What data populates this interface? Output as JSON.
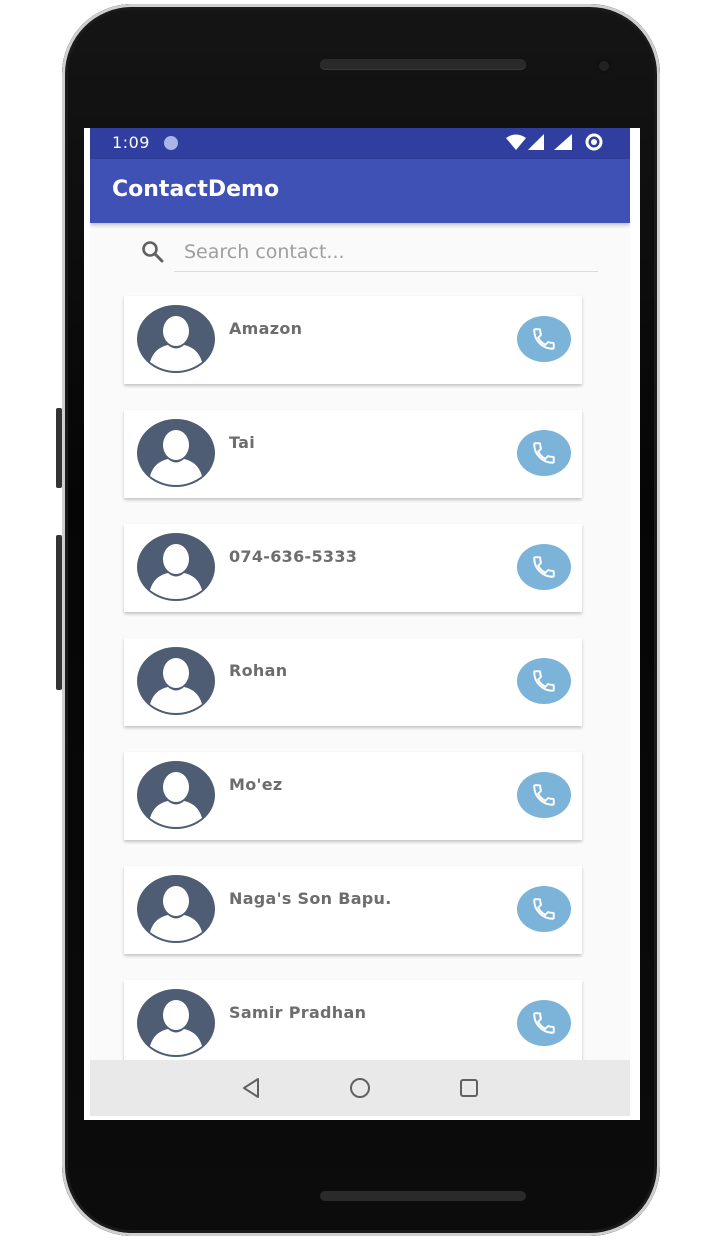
{
  "status_bar": {
    "time": "1:09",
    "icons": [
      "notification-dot-icon",
      "wifi-icon",
      "signal-icon",
      "signal-icon",
      "data-saver-icon"
    ]
  },
  "app_bar": {
    "title": "ContactDemo"
  },
  "search": {
    "placeholder": "Search contact...",
    "value": "",
    "icon": "search-icon"
  },
  "contacts": [
    {
      "name": "Amazon"
    },
    {
      "name": "Tai"
    },
    {
      "name": "074-636-5333"
    },
    {
      "name": "Rohan"
    },
    {
      "name": "Mo'ez"
    },
    {
      "name": "Naga's Son Bapu."
    },
    {
      "name": "Samir Pradhan"
    }
  ],
  "nav_bar": {
    "icons": [
      "back-icon",
      "home-icon",
      "recents-icon"
    ]
  },
  "colors": {
    "status_bar": "#303F9F",
    "app_bar": "#3F51B5",
    "avatar": "#4e5d73",
    "call_button": "#7cb3d9",
    "contact_name": "#6d6d6d"
  }
}
